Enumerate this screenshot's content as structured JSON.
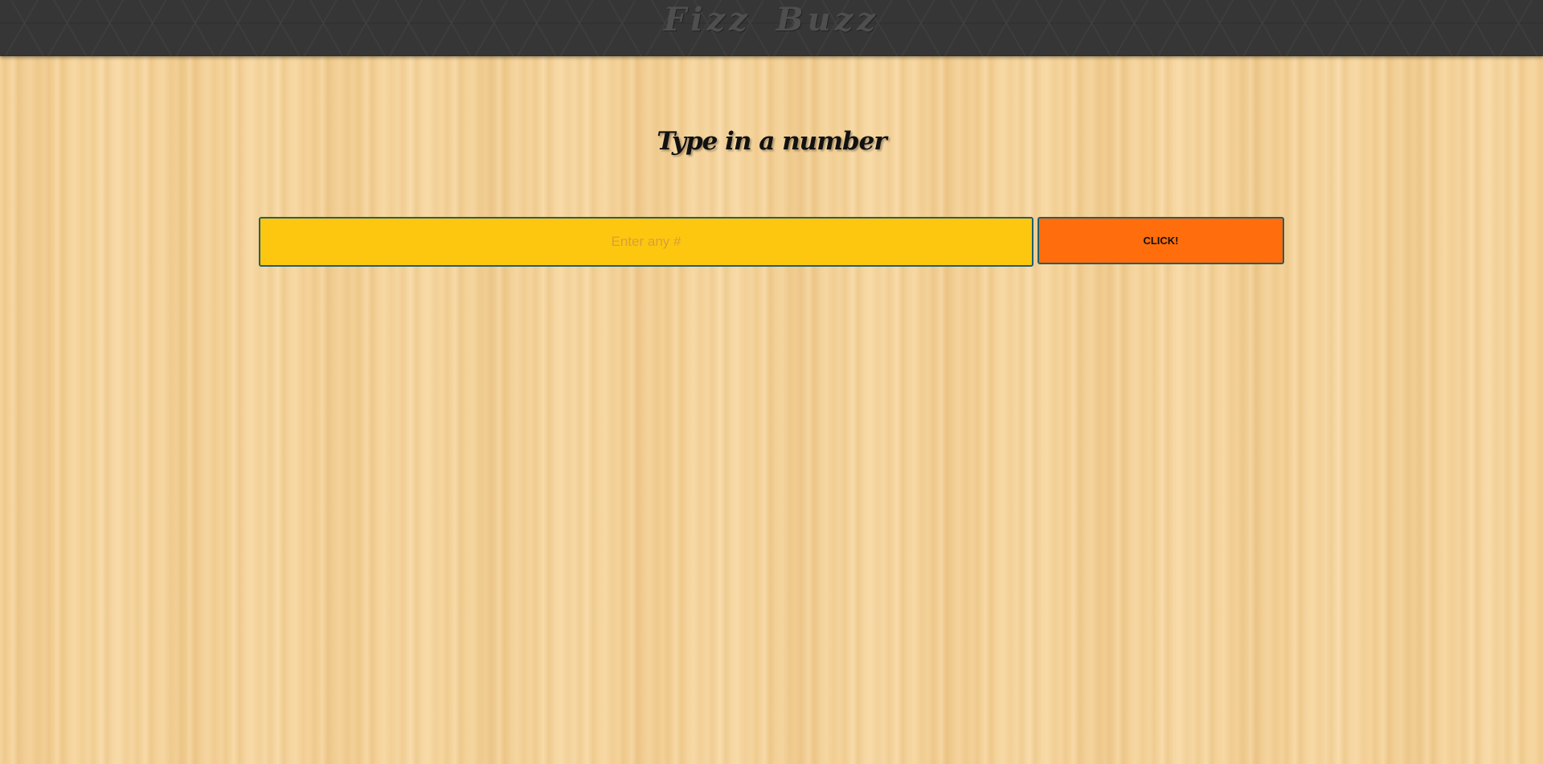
{
  "header": {
    "title": "Fizz Buzz"
  },
  "main": {
    "prompt": "Type in a number",
    "input": {
      "value": "",
      "placeholder": "Enter any #"
    },
    "button_label": "CLICK!"
  },
  "colors": {
    "header_background": "#363636",
    "header_text": "#4e4e4e",
    "page_background": "#f5d49c",
    "input_background": "#fec70f",
    "input_placeholder": "#d5a13a",
    "button_background": "#ff6d0c",
    "control_border": "#1f5f6d"
  }
}
